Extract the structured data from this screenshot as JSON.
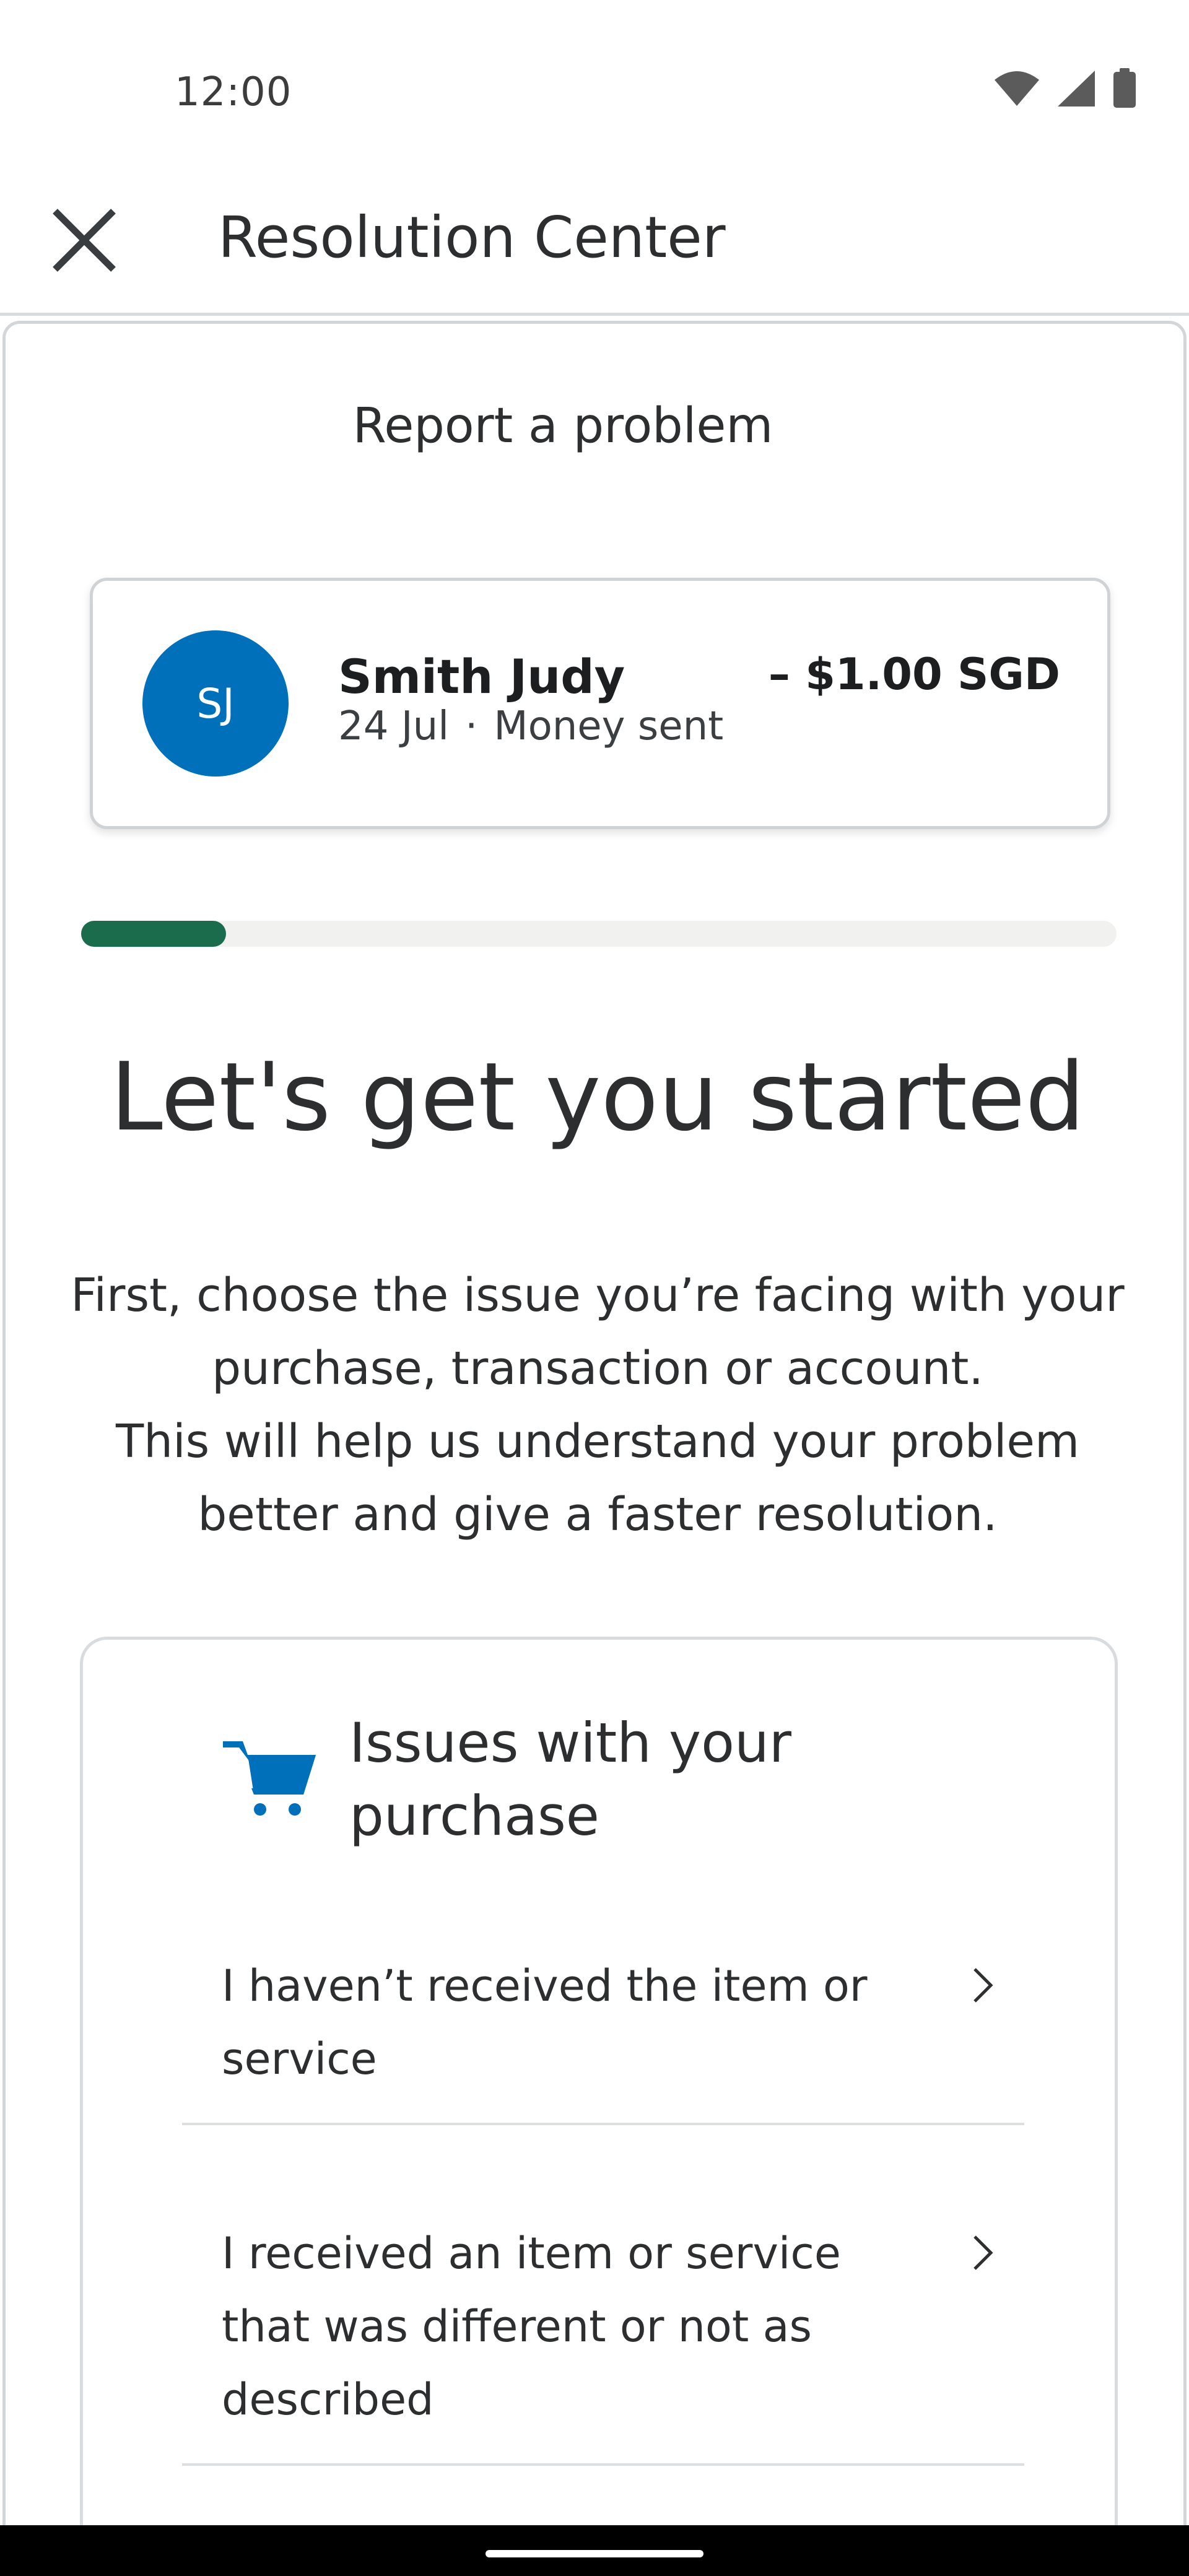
{
  "status_bar": {
    "time": "12:00",
    "icons": [
      "wifi-icon",
      "cellular-signal-icon",
      "battery-icon"
    ]
  },
  "app_bar": {
    "title": "Resolution Center",
    "close_icon": "close-icon"
  },
  "report": {
    "section_title": "Report a problem"
  },
  "transaction": {
    "avatar_initials": "SJ",
    "name": "Smith Judy",
    "date": "24 Jul",
    "separator": "·",
    "type": "Money sent",
    "amount": "– $1.00 SGD"
  },
  "progress": {
    "fraction": 0.14
  },
  "headline": "Let's get you started",
  "intro": {
    "line1": "First, choose the issue you’re facing with your purchase, transaction or account.",
    "line2": "This will help us understand your problem better and give a faster resolution."
  },
  "issues": {
    "icon": "shopping-cart-icon",
    "title": "Issues with your purchase",
    "items": [
      {
        "label": "I haven’t received the item or service"
      },
      {
        "label": "I received an item or service that was different or not as described"
      }
    ]
  },
  "colors": {
    "avatar": "#0070ba",
    "progress": "#1b6b4d",
    "cart_icon": "#0070ba"
  }
}
